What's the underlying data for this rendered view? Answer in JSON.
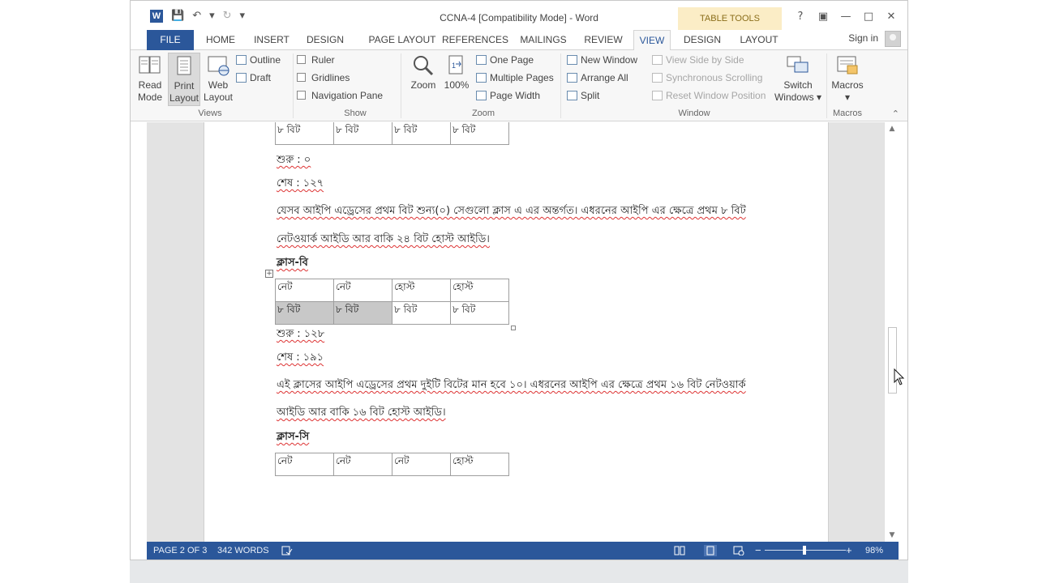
{
  "window": {
    "title": "CCNA-4 [Compatibility Mode] - Word",
    "table_tools": "TABLE TOOLS",
    "controls": {
      "help": "?",
      "ribbon_options": "▣",
      "minimize": "—",
      "maximize": "□",
      "close": "✕"
    }
  },
  "qat": {
    "app_icon": "W",
    "save": "💾",
    "undo": "↶",
    "undo_more": "▾",
    "redo": "↻",
    "customize": "▾"
  },
  "tabs": {
    "file": "FILE",
    "home": "HOME",
    "insert": "INSERT",
    "design": "DESIGN",
    "page_layout": "PAGE LAYOUT",
    "references": "REFERENCES",
    "mailings": "MAILINGS",
    "review": "REVIEW",
    "view": "VIEW",
    "table_design": "DESIGN",
    "table_layout": "LAYOUT",
    "signin": "Sign in"
  },
  "ribbon": {
    "views": {
      "label": "Views",
      "read_mode": [
        "Read",
        "Mode"
      ],
      "print_layout": [
        "Print",
        "Layout"
      ],
      "web_layout": [
        "Web",
        "Layout"
      ],
      "outline": "Outline",
      "draft": "Draft"
    },
    "show": {
      "label": "Show",
      "ruler": "Ruler",
      "gridlines": "Gridlines",
      "navigation_pane": "Navigation Pane"
    },
    "zoom": {
      "label": "Zoom",
      "zoom": "Zoom",
      "hundred": "100%",
      "one_page": "One Page",
      "multiple_pages": "Multiple Pages",
      "page_width": "Page Width"
    },
    "window": {
      "label": "Window",
      "new_window": "New Window",
      "arrange_all": "Arrange All",
      "split": "Split",
      "view_side_by_side": "View Side by Side",
      "synchronous_scrolling": "Synchronous Scrolling",
      "reset_window_position": "Reset Window Position",
      "switch_windows": [
        "Switch",
        "Windows ▾"
      ]
    },
    "macros": {
      "label": "Macros",
      "macros": "Macros",
      "dropdown": "▾"
    },
    "collapse": "⌃"
  },
  "document": {
    "table_a_row": [
      "৮ বিট",
      "৮ বিট",
      "৮ বিট",
      "৮ বিট"
    ],
    "start_a": "শুরু : ০",
    "end_a": "শেষ : ১২৭",
    "para_a1": "যেসব আইপি এড্রেসের প্রথম বিট শুন্য(০) সেগুলো ক্লাস এ এর অন্তর্গত। এধরনের আইপি এর ক্ষেত্রে প্রথম ৮ বিট",
    "para_a2": "নেটওয়ার্ক আইডি আর বাকি ২৪ বিট হোস্ট আইডি।",
    "heading_b": "ক্লাস-বি",
    "table_b_row1": [
      "নেট",
      "নেট",
      "হোস্ট",
      "হোস্ট"
    ],
    "table_b_row2": [
      "৮ বিট",
      "৮ বিট",
      "৮ বিট",
      "৮ বিট"
    ],
    "start_b": "শুরু : ১২৮",
    "end_b": "শেষ : ১৯১",
    "para_b1": "এই ক্লাসের আইপি এড্রেসের প্রথম দুইটি বিটের মান হবে ১০। এধরনের আইপি এর ক্ষেত্রে প্রথম ১৬ বিট নেটওয়ার্ক",
    "para_b2": "আইডি আর বাকি ১৬ বিট হোস্ট আইডি।",
    "heading_c": "ক্লাস-সি",
    "table_c_row1": [
      "নেট",
      "নেট",
      "নেট",
      "হোস্ট"
    ]
  },
  "status": {
    "page": "PAGE 2 OF 3",
    "words": "342 WORDS",
    "zoom_minus": "−",
    "zoom_plus": "+",
    "zoom_level": "98%",
    "zoom_fraction": 0.49
  },
  "colors": {
    "accent": "#2b579a",
    "table_tools": "#fbedc6"
  }
}
